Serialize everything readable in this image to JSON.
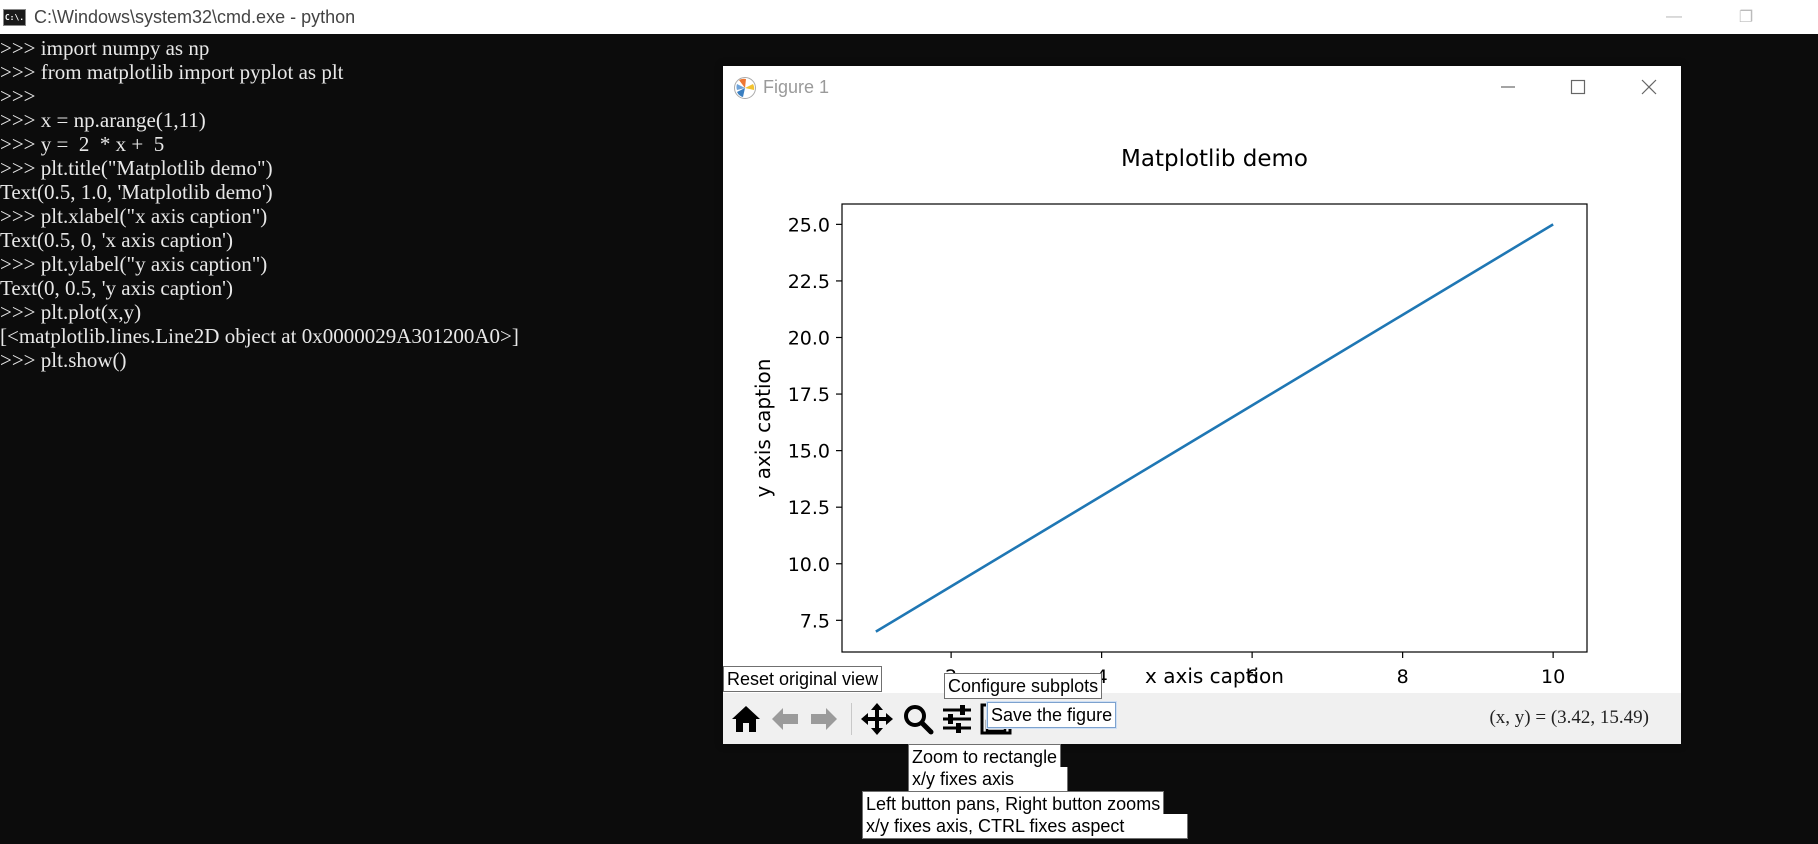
{
  "console_window": {
    "title": "C:\\Windows\\system32\\cmd.exe - python",
    "icon_text": "C:\\.",
    "lines": [
      ">>> import numpy as np",
      ">>> from matplotlib import pyplot as plt",
      ">>>",
      ">>> x = np.arange(1,11)",
      ">>> y =  2  * x +  5",
      ">>> plt.title(\"Matplotlib demo\")",
      "Text(0.5, 1.0, 'Matplotlib demo')",
      ">>> plt.xlabel(\"x axis caption\")",
      "Text(0.5, 0, 'x axis caption')",
      ">>> plt.ylabel(\"y axis caption\")",
      "Text(0, 0.5, 'y axis caption')",
      ">>> plt.plot(x,y)",
      "[<matplotlib.lines.Line2D object at 0x0000029A301200A0>]",
      ">>> plt.show()"
    ]
  },
  "figure_window": {
    "title": "Figure 1",
    "coords_readout": "(x, y) = (3.42, 15.49)",
    "toolbar": {
      "home": "home-icon",
      "back": "arrow-left-icon",
      "forward": "arrow-right-icon",
      "pan": "move-icon",
      "zoom": "magnifier-icon",
      "configure": "sliders-icon",
      "save": "floppy-icon"
    },
    "tooltips": {
      "reset": "Reset original view",
      "configure": "Configure subplots",
      "save": "Save the figure",
      "zoom_1": "Zoom to rectangle",
      "zoom_2": "x/y fixes axis",
      "pan_1": "Left button pans, Right button zooms",
      "pan_2": "x/y fixes axis, CTRL fixes aspect"
    }
  },
  "chart_data": {
    "type": "line",
    "title": "Matplotlib demo",
    "xlabel": "x axis caption",
    "ylabel": "y axis caption",
    "x": [
      1,
      2,
      3,
      4,
      5,
      6,
      7,
      8,
      9,
      10
    ],
    "series": [
      {
        "values": [
          7,
          9,
          11,
          13,
          15,
          17,
          19,
          21,
          23,
          25
        ],
        "color": "#1f77b4"
      }
    ],
    "xlim": [
      0.55,
      10.45
    ],
    "ylim": [
      6.1,
      25.9
    ],
    "xticks": [
      2,
      4,
      6,
      8,
      10
    ],
    "xtick_labels": [
      "2",
      "4",
      "6",
      "8",
      "10"
    ],
    "yticks": [
      7.5,
      10.0,
      12.5,
      15.0,
      17.5,
      20.0,
      22.5,
      25.0
    ],
    "ytick_labels": [
      "7.5",
      "10.0",
      "12.5",
      "15.0",
      "17.5",
      "20.0",
      "22.5",
      "25.0"
    ],
    "grid": false
  }
}
